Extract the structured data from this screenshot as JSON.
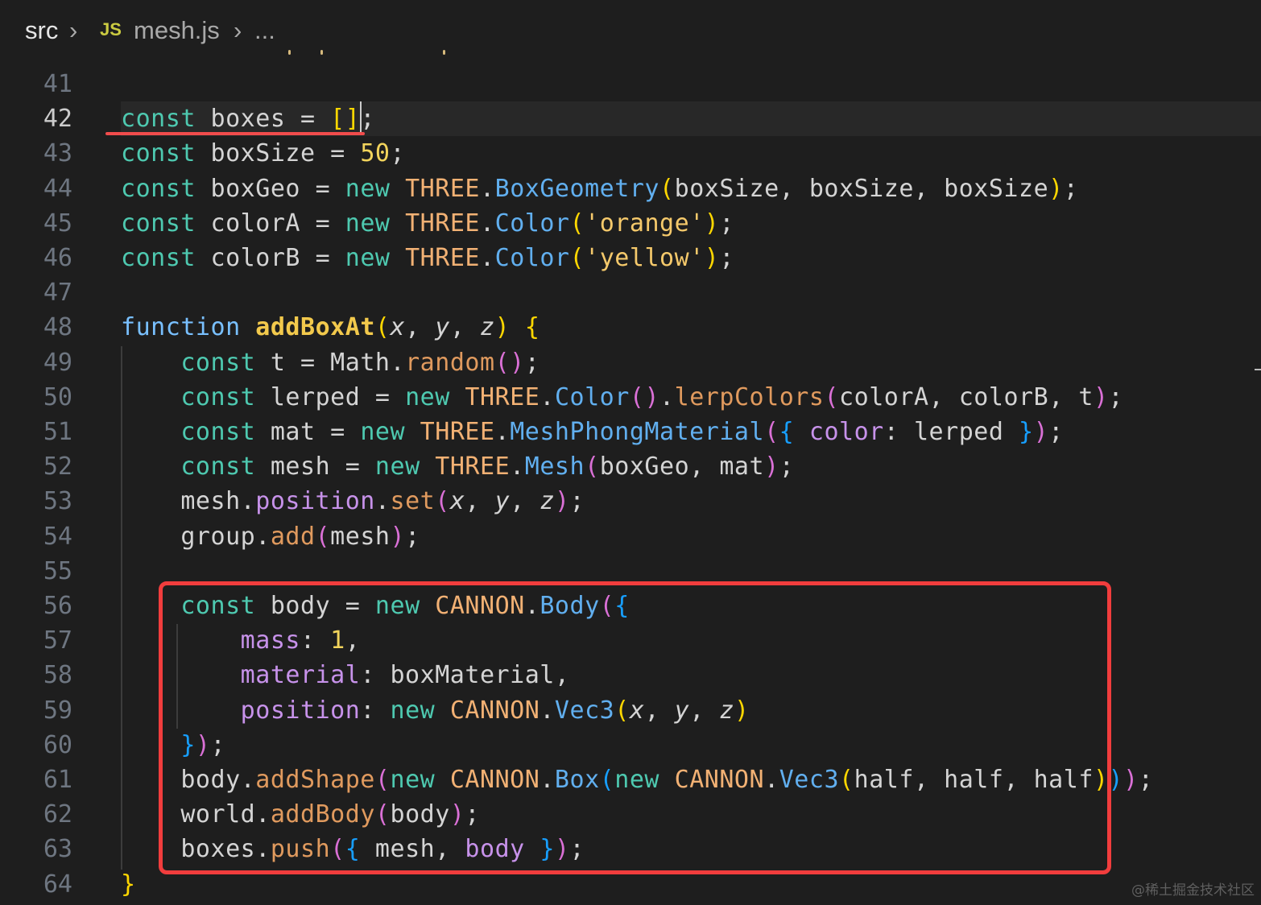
{
  "breadcrumb": {
    "folder": "src",
    "file_icon": "JS",
    "file": "mesh.js",
    "more": "..."
  },
  "watermark": "@稀土掘金技术社区",
  "lines": [
    {
      "n": "41",
      "tokens": []
    },
    {
      "n": "42",
      "tokens": [
        [
          "kc",
          "const"
        ],
        [
          "v",
          " boxes = "
        ],
        [
          "par",
          "[]"
        ],
        [
          "v",
          ";"
        ]
      ]
    },
    {
      "n": "43",
      "tokens": [
        [
          "kc",
          "const"
        ],
        [
          "v",
          " boxSize = "
        ],
        [
          "num",
          "50"
        ],
        [
          "v",
          ";"
        ]
      ]
    },
    {
      "n": "44",
      "tokens": [
        [
          "kc",
          "const"
        ],
        [
          "v",
          " boxGeo = "
        ],
        [
          "kc",
          "new"
        ],
        [
          "v",
          " "
        ],
        [
          "cls",
          "THREE"
        ],
        [
          "v",
          "."
        ],
        [
          "fn",
          "BoxGeometry"
        ],
        [
          "par",
          "("
        ],
        [
          "v",
          "boxSize, boxSize, boxSize"
        ],
        [
          "par",
          ")"
        ],
        [
          "v",
          ";"
        ]
      ]
    },
    {
      "n": "45",
      "tokens": [
        [
          "kc",
          "const"
        ],
        [
          "v",
          " colorA = "
        ],
        [
          "kc",
          "new"
        ],
        [
          "v",
          " "
        ],
        [
          "cls",
          "THREE"
        ],
        [
          "v",
          "."
        ],
        [
          "fn",
          "Color"
        ],
        [
          "par",
          "("
        ],
        [
          "s",
          "'orange'"
        ],
        [
          "par",
          ")"
        ],
        [
          "v",
          ";"
        ]
      ]
    },
    {
      "n": "46",
      "tokens": [
        [
          "kc",
          "const"
        ],
        [
          "v",
          " colorB = "
        ],
        [
          "kc",
          "new"
        ],
        [
          "v",
          " "
        ],
        [
          "cls",
          "THREE"
        ],
        [
          "v",
          "."
        ],
        [
          "fn",
          "Color"
        ],
        [
          "par",
          "("
        ],
        [
          "s",
          "'yellow'"
        ],
        [
          "par",
          ")"
        ],
        [
          "v",
          ";"
        ]
      ]
    },
    {
      "n": "47",
      "tokens": []
    },
    {
      "n": "48",
      "tokens": [
        [
          "kw",
          "function"
        ],
        [
          "v",
          " "
        ],
        [
          "fdef",
          "addBoxAt"
        ],
        [
          "par",
          "("
        ],
        [
          "pm",
          "x"
        ],
        [
          "v",
          ", "
        ],
        [
          "pm",
          "y"
        ],
        [
          "v",
          ", "
        ],
        [
          "pm",
          "z"
        ],
        [
          "par",
          ")"
        ],
        [
          "v",
          " "
        ],
        [
          "par",
          "{"
        ]
      ]
    },
    {
      "n": "49",
      "tokens": [
        [
          "v",
          "    "
        ],
        [
          "kc",
          "const"
        ],
        [
          "v",
          " t = Math."
        ],
        [
          "m",
          "random"
        ],
        [
          "par2",
          "()"
        ],
        [
          "v",
          ";"
        ]
      ]
    },
    {
      "n": "50",
      "tokens": [
        [
          "v",
          "    "
        ],
        [
          "kc",
          "const"
        ],
        [
          "v",
          " lerped = "
        ],
        [
          "kc",
          "new"
        ],
        [
          "v",
          " "
        ],
        [
          "cls",
          "THREE"
        ],
        [
          "v",
          "."
        ],
        [
          "fn",
          "Color"
        ],
        [
          "par2",
          "()"
        ],
        [
          "v",
          "."
        ],
        [
          "m",
          "lerpColors"
        ],
        [
          "par2",
          "("
        ],
        [
          "v",
          "colorA, colorB, t"
        ],
        [
          "par2",
          ")"
        ],
        [
          "v",
          ";"
        ]
      ]
    },
    {
      "n": "51",
      "tokens": [
        [
          "v",
          "    "
        ],
        [
          "kc",
          "const"
        ],
        [
          "v",
          " mat = "
        ],
        [
          "kc",
          "new"
        ],
        [
          "v",
          " "
        ],
        [
          "cls",
          "THREE"
        ],
        [
          "v",
          "."
        ],
        [
          "fn",
          "MeshPhongMaterial"
        ],
        [
          "par2",
          "("
        ],
        [
          "par3",
          "{"
        ],
        [
          "v",
          " "
        ],
        [
          "p",
          "color"
        ],
        [
          "v",
          ": lerped "
        ],
        [
          "par3",
          "}"
        ],
        [
          "par2",
          ")"
        ],
        [
          "v",
          ";"
        ]
      ]
    },
    {
      "n": "52",
      "tokens": [
        [
          "v",
          "    "
        ],
        [
          "kc",
          "const"
        ],
        [
          "v",
          " mesh = "
        ],
        [
          "kc",
          "new"
        ],
        [
          "v",
          " "
        ],
        [
          "cls",
          "THREE"
        ],
        [
          "v",
          "."
        ],
        [
          "fn",
          "Mesh"
        ],
        [
          "par2",
          "("
        ],
        [
          "v",
          "boxGeo, mat"
        ],
        [
          "par2",
          ")"
        ],
        [
          "v",
          ";"
        ]
      ]
    },
    {
      "n": "53",
      "tokens": [
        [
          "v",
          "    mesh."
        ],
        [
          "p",
          "position"
        ],
        [
          "v",
          "."
        ],
        [
          "m",
          "set"
        ],
        [
          "par2",
          "("
        ],
        [
          "pm",
          "x"
        ],
        [
          "v",
          ", "
        ],
        [
          "pm",
          "y"
        ],
        [
          "v",
          ", "
        ],
        [
          "pm",
          "z"
        ],
        [
          "par2",
          ")"
        ],
        [
          "v",
          ";"
        ]
      ]
    },
    {
      "n": "54",
      "tokens": [
        [
          "v",
          "    group."
        ],
        [
          "m",
          "add"
        ],
        [
          "par2",
          "("
        ],
        [
          "v",
          "mesh"
        ],
        [
          "par2",
          ")"
        ],
        [
          "v",
          ";"
        ]
      ]
    },
    {
      "n": "55",
      "tokens": []
    },
    {
      "n": "56",
      "tokens": [
        [
          "v",
          "    "
        ],
        [
          "kc",
          "const"
        ],
        [
          "v",
          " body = "
        ],
        [
          "kc",
          "new"
        ],
        [
          "v",
          " "
        ],
        [
          "cls",
          "CANNON"
        ],
        [
          "v",
          "."
        ],
        [
          "fn",
          "Body"
        ],
        [
          "par2",
          "("
        ],
        [
          "par3",
          "{"
        ]
      ]
    },
    {
      "n": "57",
      "tokens": [
        [
          "v",
          "        "
        ],
        [
          "p",
          "mass"
        ],
        [
          "v",
          ": "
        ],
        [
          "num",
          "1"
        ],
        [
          "v",
          ","
        ]
      ]
    },
    {
      "n": "58",
      "tokens": [
        [
          "v",
          "        "
        ],
        [
          "p",
          "material"
        ],
        [
          "v",
          ": boxMaterial,"
        ]
      ]
    },
    {
      "n": "59",
      "tokens": [
        [
          "v",
          "        "
        ],
        [
          "p",
          "position"
        ],
        [
          "v",
          ": "
        ],
        [
          "kc",
          "new"
        ],
        [
          "v",
          " "
        ],
        [
          "cls",
          "CANNON"
        ],
        [
          "v",
          "."
        ],
        [
          "fn",
          "Vec3"
        ],
        [
          "par",
          "("
        ],
        [
          "pm",
          "x"
        ],
        [
          "v",
          ", "
        ],
        [
          "pm",
          "y"
        ],
        [
          "v",
          ", "
        ],
        [
          "pm",
          "z"
        ],
        [
          "par",
          ")"
        ]
      ]
    },
    {
      "n": "60",
      "tokens": [
        [
          "v",
          "    "
        ],
        [
          "par3",
          "}"
        ],
        [
          "par2",
          ")"
        ],
        [
          "v",
          ";"
        ]
      ]
    },
    {
      "n": "61",
      "tokens": [
        [
          "v",
          "    body."
        ],
        [
          "m",
          "addShape"
        ],
        [
          "par2",
          "("
        ],
        [
          "kc",
          "new"
        ],
        [
          "v",
          " "
        ],
        [
          "cls",
          "CANNON"
        ],
        [
          "v",
          "."
        ],
        [
          "fn",
          "Box"
        ],
        [
          "par3",
          "("
        ],
        [
          "kc",
          "new"
        ],
        [
          "v",
          " "
        ],
        [
          "cls",
          "CANNON"
        ],
        [
          "v",
          "."
        ],
        [
          "fn",
          "Vec3"
        ],
        [
          "par",
          "("
        ],
        [
          "v",
          "half, half, half"
        ],
        [
          "par",
          ")"
        ],
        [
          "par3",
          ")"
        ],
        [
          "par2",
          ")"
        ],
        [
          "v",
          ";"
        ]
      ]
    },
    {
      "n": "62",
      "tokens": [
        [
          "v",
          "    world."
        ],
        [
          "m",
          "addBody"
        ],
        [
          "par2",
          "("
        ],
        [
          "v",
          "body"
        ],
        [
          "par2",
          ")"
        ],
        [
          "v",
          ";"
        ]
      ]
    },
    {
      "n": "63",
      "tokens": [
        [
          "v",
          "    boxes."
        ],
        [
          "m",
          "push"
        ],
        [
          "par2",
          "("
        ],
        [
          "par3",
          "{"
        ],
        [
          "v",
          " mesh, "
        ],
        [
          "p",
          "body"
        ],
        [
          "v",
          " "
        ],
        [
          "par3",
          "}"
        ],
        [
          "par2",
          ")"
        ],
        [
          "v",
          ";"
        ]
      ]
    },
    {
      "n": "64",
      "tokens": [
        [
          "par",
          "}"
        ]
      ]
    }
  ]
}
